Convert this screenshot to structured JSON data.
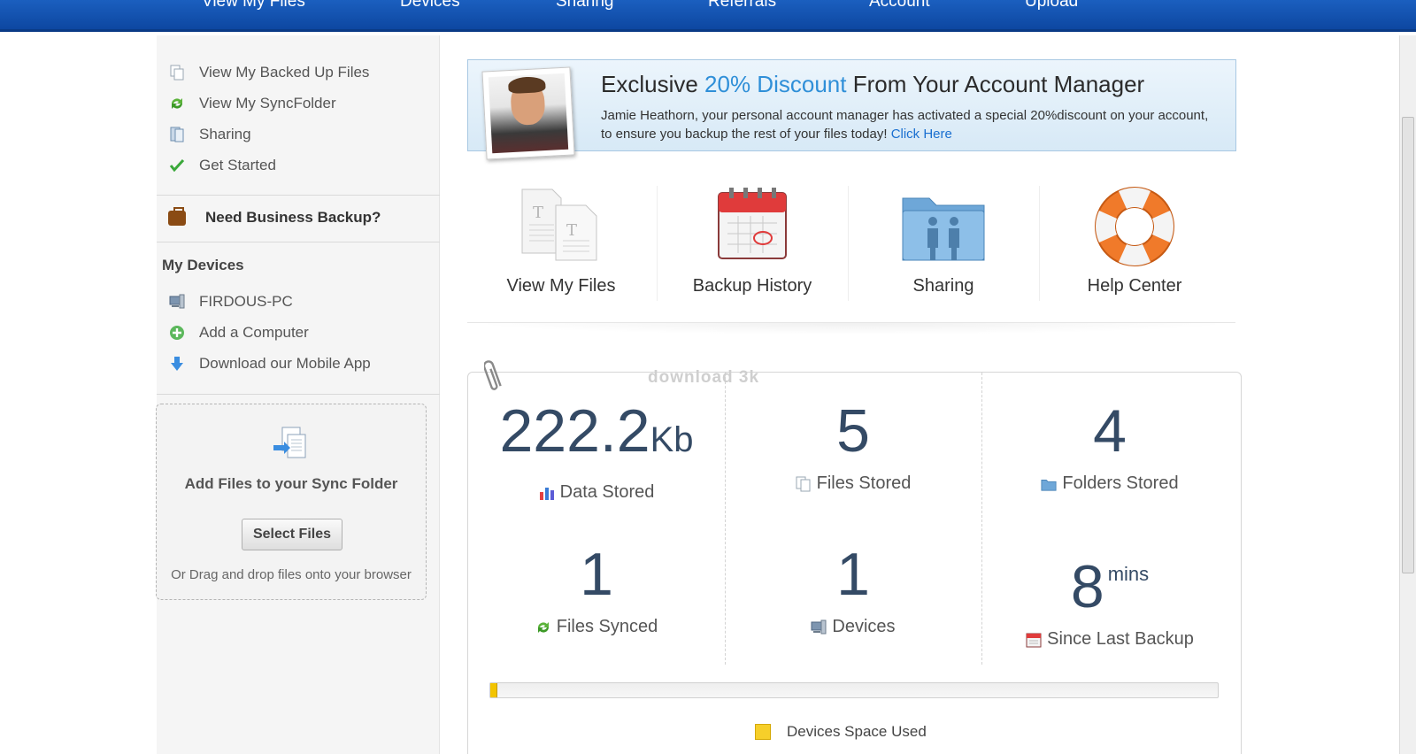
{
  "topnav": {
    "items": [
      "View My Files",
      "Devices",
      "Sharing",
      "Referrals",
      "Account",
      "Upload"
    ]
  },
  "sidebar": {
    "links": [
      {
        "label": "View My Backed Up Files",
        "icon": "files-icon"
      },
      {
        "label": "View My SyncFolder",
        "icon": "sync-icon"
      },
      {
        "label": "Sharing",
        "icon": "share-icon"
      },
      {
        "label": "Get Started",
        "icon": "checkmark-icon"
      }
    ],
    "business_label": "Need Business Backup?",
    "devices_heading": "My Devices",
    "device_links": [
      {
        "label": "FIRDOUS-PC",
        "icon": "computer-icon"
      },
      {
        "label": "Add a Computer",
        "icon": "add-icon"
      },
      {
        "label": "Download our Mobile App",
        "icon": "download-arrow-icon"
      }
    ],
    "sync_box": {
      "title": "Add Files to your Sync Folder",
      "button": "Select Files",
      "hint": "Or Drag and drop files onto your browser"
    }
  },
  "banner": {
    "headline_pre": "Exclusive ",
    "headline_accent": "20% Discount",
    "headline_post": " From Your Account Manager",
    "body": "Jamie Heathorn, your personal account manager has activated a special 20%discount on your account, to ensure you backup the rest of your files today! ",
    "link": "Click Here",
    "accent_color": "#2f8fd8"
  },
  "quick_links": [
    {
      "label": "View My Files",
      "icon": "documents-icon"
    },
    {
      "label": "Backup History",
      "icon": "calendar-icon"
    },
    {
      "label": "Sharing",
      "icon": "shared-folder-icon"
    },
    {
      "label": "Help Center",
      "icon": "lifebuoy-icon"
    }
  ],
  "watermark": "download 3k",
  "stats": {
    "data_stored": {
      "value": "222.2",
      "unit": "Kb",
      "label": "Data Stored"
    },
    "files_stored": {
      "value": "5",
      "label": "Files Stored"
    },
    "folders_stored": {
      "value": "4",
      "label": "Folders Stored"
    },
    "files_synced": {
      "value": "1",
      "label": "Files Synced"
    },
    "devices": {
      "value": "1",
      "label": "Devices"
    },
    "since_backup": {
      "value": "8",
      "unit": "mins",
      "label": "Since Last Backup"
    }
  },
  "space": {
    "used_fraction": 0.01,
    "legend": "Devices Space Used",
    "fill_color": "#f3c400"
  }
}
